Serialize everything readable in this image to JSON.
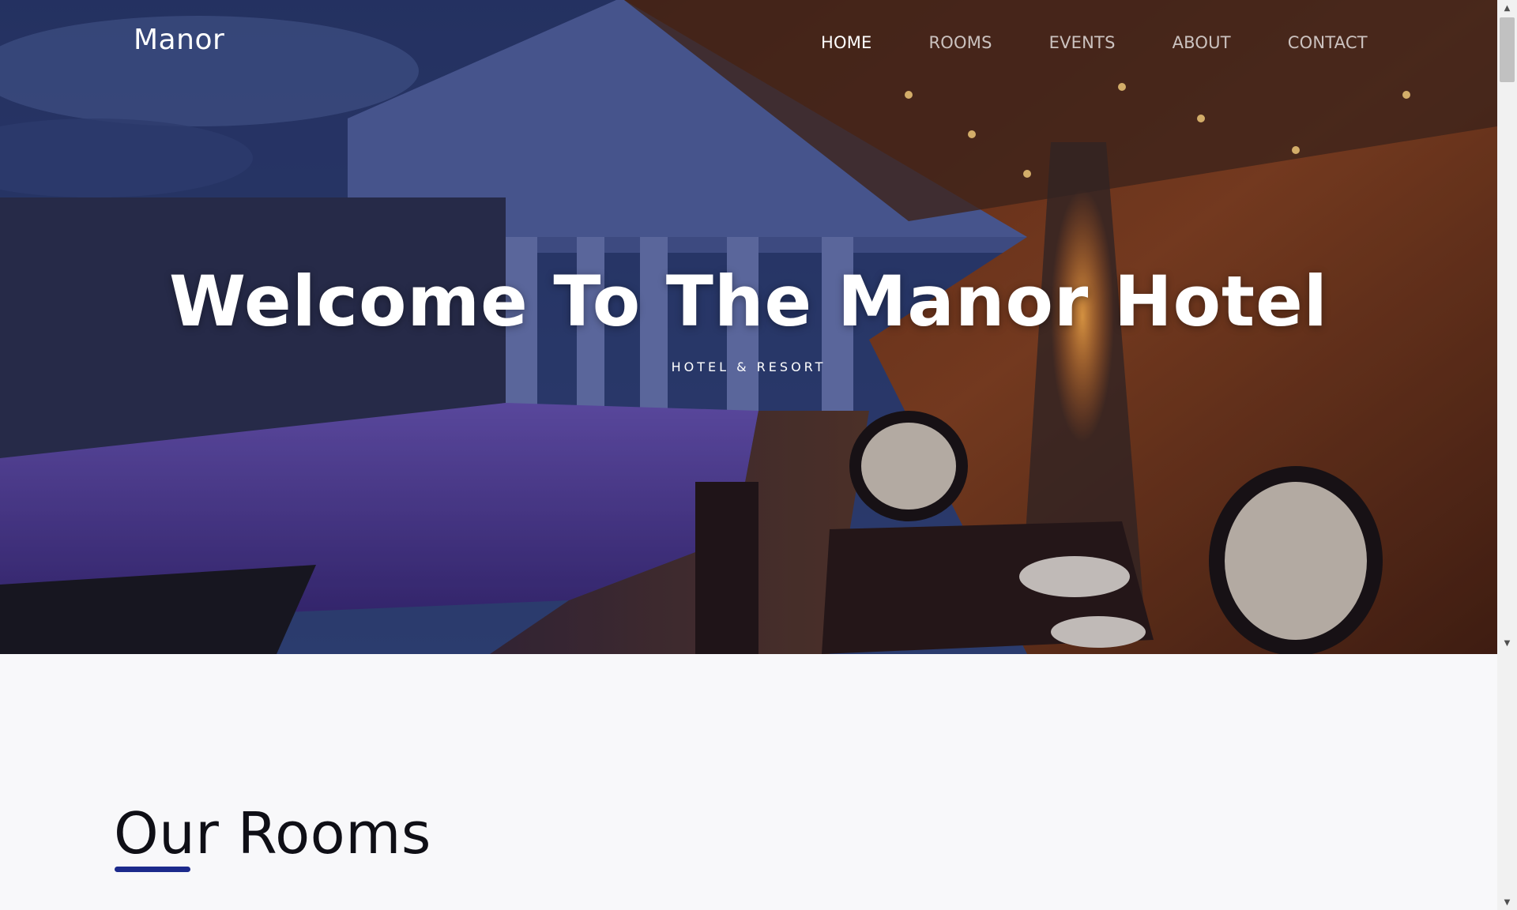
{
  "navbar": {
    "brand": "Manor",
    "links": [
      {
        "label": "HOME",
        "active": true
      },
      {
        "label": "ROOMS",
        "active": false
      },
      {
        "label": "EVENTS",
        "active": false
      },
      {
        "label": "ABOUT",
        "active": false
      },
      {
        "label": "CONTACT",
        "active": false
      }
    ]
  },
  "hero": {
    "title": "Welcome To The Manor Hotel",
    "subtitle": "HOTEL & RESORT"
  },
  "rooms": {
    "title": "Our Rooms"
  },
  "colors": {
    "accent": "#1c2a8c",
    "text_dark": "#0f0f16",
    "page_background": "#f8f8fa"
  },
  "icons": {
    "scroll_up": "triangle-up-icon",
    "scroll_down": "triangle-down-icon"
  }
}
